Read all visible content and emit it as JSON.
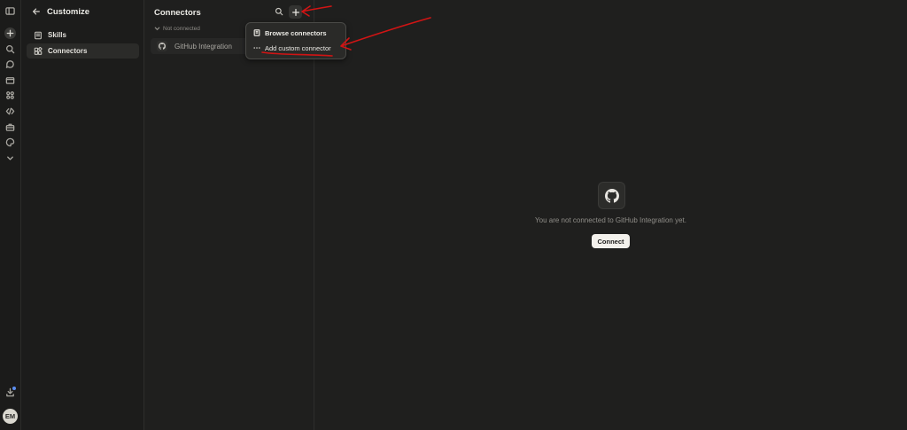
{
  "rail": {
    "icons": [
      "sidebar-toggle-icon",
      "new-chat-icon",
      "search-icon",
      "chats-icon",
      "projects-icon",
      "artifacts-icon",
      "code-icon",
      "customize-icon",
      "palette-icon",
      "chevron-down-icon",
      "download-icon"
    ],
    "user_initials": "EM"
  },
  "customize": {
    "title": "Customize",
    "nav": [
      {
        "label": "Skills",
        "icon": "skills-icon"
      },
      {
        "label": "Connectors",
        "icon": "connectors-icon",
        "active": true
      }
    ]
  },
  "connectors": {
    "title": "Connectors",
    "section_label": "Not connected",
    "items": [
      {
        "name": "GitHub Integration",
        "icon": "github-icon"
      }
    ]
  },
  "add_menu": {
    "items": [
      {
        "label": "Browse connectors",
        "icon": "book-icon"
      },
      {
        "label": "Add custom connector",
        "icon": "more-dots-icon"
      }
    ]
  },
  "detail": {
    "message": "You are not connected to GitHub Integration yet.",
    "connect_label": "Connect"
  },
  "colors": {
    "background": "#1f1f1e",
    "button_bg": "#f3f1ec",
    "annotation": "#d11414"
  }
}
